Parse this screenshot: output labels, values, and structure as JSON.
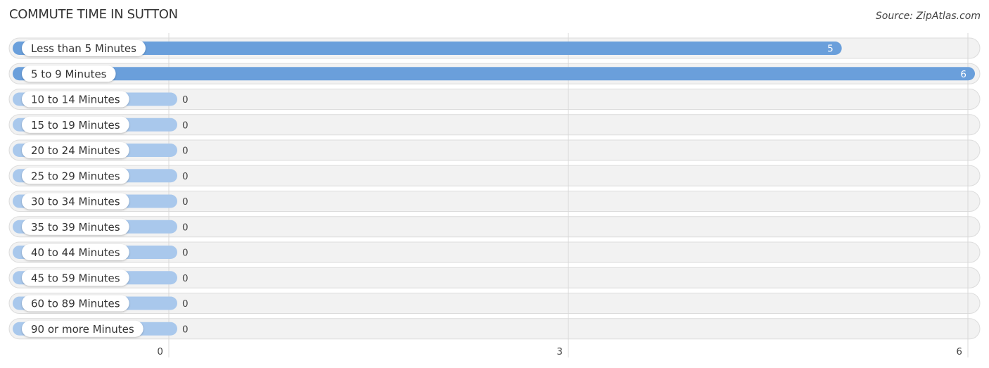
{
  "chart_data": {
    "type": "bar",
    "orientation": "horizontal",
    "title": "COMMUTE TIME IN SUTTON",
    "source": "Source: ZipAtlas.com",
    "categories": [
      "Less than 5 Minutes",
      "5 to 9 Minutes",
      "10 to 14 Minutes",
      "15 to 19 Minutes",
      "20 to 24 Minutes",
      "25 to 29 Minutes",
      "30 to 34 Minutes",
      "35 to 39 Minutes",
      "40 to 44 Minutes",
      "45 to 59 Minutes",
      "60 to 89 Minutes",
      "90 or more Minutes"
    ],
    "values": [
      5,
      6,
      0,
      0,
      0,
      0,
      0,
      0,
      0,
      0,
      0,
      0
    ],
    "xlim": [
      0,
      6
    ],
    "xticks": [
      0,
      3,
      6
    ],
    "xlabel": "",
    "ylabel": "",
    "grid": true,
    "colors": {
      "bar_strong": "#6a9fdb",
      "bar_light": "#a9c8ec",
      "track": "#f2f2f2"
    }
  }
}
